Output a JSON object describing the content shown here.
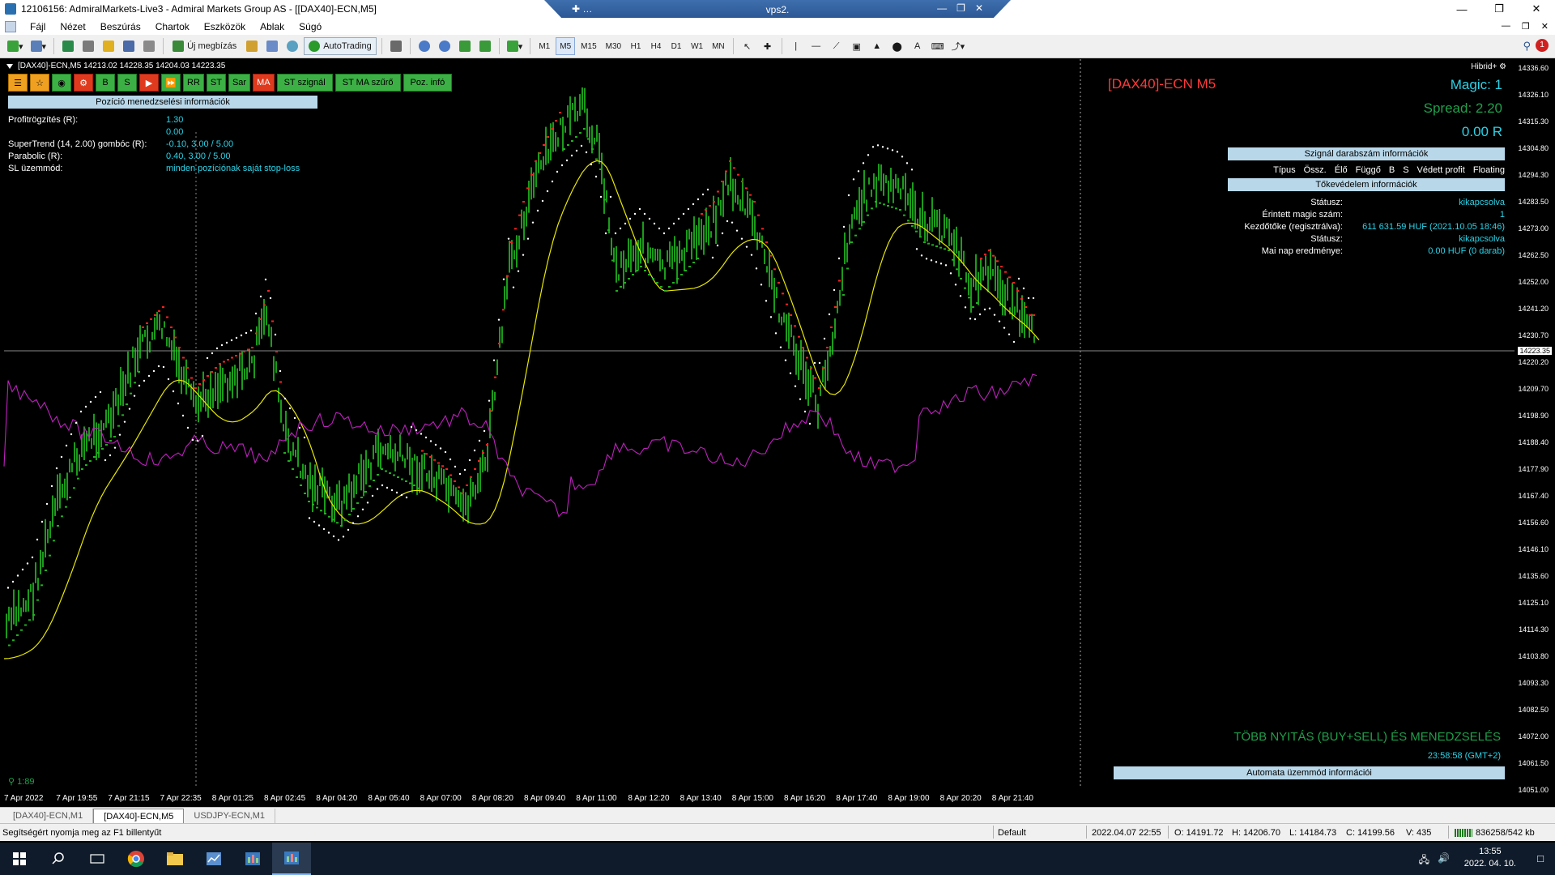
{
  "window": {
    "title": "12106156: AdmiralMarkets-Live3 - Admiral Markets Group AS - [[DAX40]-ECN,M5]",
    "vps_name": "vps2."
  },
  "menu": [
    "Fájl",
    "Nézet",
    "Beszúrás",
    "Chartok",
    "Eszközök",
    "Ablak",
    "Súgó"
  ],
  "toolbar": {
    "new_order": "Új megbízás",
    "autotrading": "AutoTrading",
    "periods": [
      "M1",
      "M5",
      "M15",
      "M30",
      "H1",
      "H4",
      "D1",
      "W1",
      "MN"
    ],
    "active_period": "M5"
  },
  "chart": {
    "header": "[DAX40]-ECN,M5  14213.02 14228.35 14204.03 14223.35",
    "hibrid": "Hibrid+",
    "buttons": [
      "B",
      "S",
      "RR",
      "ST",
      "Sar",
      "MA",
      "ST szignál",
      "ST MA szűrő",
      "Poz. infó"
    ],
    "left_panel": {
      "title": "Pozíció menedzselési információk",
      "rows": [
        {
          "k": "Profitrögzítés (R):",
          "v": "1.30"
        },
        {
          "k": "",
          "v": "0.00"
        },
        {
          "k": "SuperTrend (14, 2.00) gombóc (R):",
          "v": "-0.10, 3.00 / 5.00"
        },
        {
          "k": "Parabolic (R):",
          "v": "0.40, 3.00 / 5.00"
        },
        {
          "k": "SL üzemmód:",
          "v": "minden pozíciónak saját stop-loss"
        }
      ]
    },
    "symbol_title": "[DAX40]-ECN M5",
    "magic": "Magic: 1",
    "spread": "Spread: 2.20",
    "r_value": "0.00 R",
    "signal_bar": "Szignál darabszám információk",
    "signal_cols": [
      "Típus",
      "Össz.",
      "Élő",
      "Függő",
      "B",
      "S",
      "Védett profit",
      "Floating"
    ],
    "capital_bar": "Tőkevédelem információk",
    "capital_rows": [
      {
        "k": "Státusz:",
        "v": "kikapcsolva"
      },
      {
        "k": "Érintett magic szám:",
        "v": "1"
      },
      {
        "k": "Kezdőtőke (regisztrálva):",
        "v": "611 631.59 HUF (2021.10.05 18:46)"
      },
      {
        "k": "Státusz:",
        "v": "kikapcsolva"
      },
      {
        "k": "Mai nap eredménye:",
        "v": "0.00 HUF (0 darab)"
      }
    ],
    "footer_title": "TÖBB NYITÁS (BUY+SELL) ÉS MENEDZSELÉS",
    "footer_time": "23:58:58 (GMT+2)",
    "auto_bar": "Automata üzemmód információi",
    "scale": "1:89",
    "price_labels": [
      "14336.60",
      "14326.10",
      "14315.30",
      "14304.80",
      "14294.30",
      "14283.50",
      "14273.00",
      "14262.50",
      "14252.00",
      "14241.20",
      "14230.70",
      "14220.20",
      "14209.70",
      "14198.90",
      "14188.40",
      "14177.90",
      "14167.40",
      "14156.60",
      "14146.10",
      "14135.60",
      "14125.10",
      "14114.30",
      "14103.80",
      "14093.30",
      "14082.50",
      "14072.00",
      "14061.50",
      "14051.00"
    ],
    "current_price": "14223.35",
    "time_labels": [
      "7 Apr 2022",
      "7 Apr 19:55",
      "7 Apr 21:15",
      "7 Apr 22:35",
      "8 Apr 01:25",
      "8 Apr 02:45",
      "8 Apr 04:20",
      "8 Apr 05:40",
      "8 Apr 07:00",
      "8 Apr 08:20",
      "8 Apr 09:40",
      "8 Apr 11:00",
      "8 Apr 12:20",
      "8 Apr 13:40",
      "8 Apr 15:00",
      "8 Apr 16:20",
      "8 Apr 17:40",
      "8 Apr 19:00",
      "8 Apr 20:20",
      "8 Apr 21:40"
    ],
    "colors": {
      "candle": "#22c322",
      "ma": "#e8e800",
      "purple": "#c020c0",
      "sar": "#ffffff",
      "red_dots": "#ff2020",
      "green_dots": "#20b020"
    }
  },
  "tabs": [
    "[DAX40]-ECN,M1",
    "[DAX40]-ECN,M5",
    "USDJPY-ECN,M1"
  ],
  "active_tab": "[DAX40]-ECN,M5",
  "status": {
    "help": "Segítségért nyomja meg az F1 billentyűt",
    "profile": "Default",
    "datetime": "2022.04.07 22:55",
    "open": "O: 14191.72",
    "high": "H: 14206.70",
    "low": "L: 14184.73",
    "close": "C: 14199.56",
    "volume": "V: 435",
    "traffic": "836258/542 kb"
  },
  "taskbar": {
    "time": "13:55",
    "date": "2022. 04. 10."
  }
}
